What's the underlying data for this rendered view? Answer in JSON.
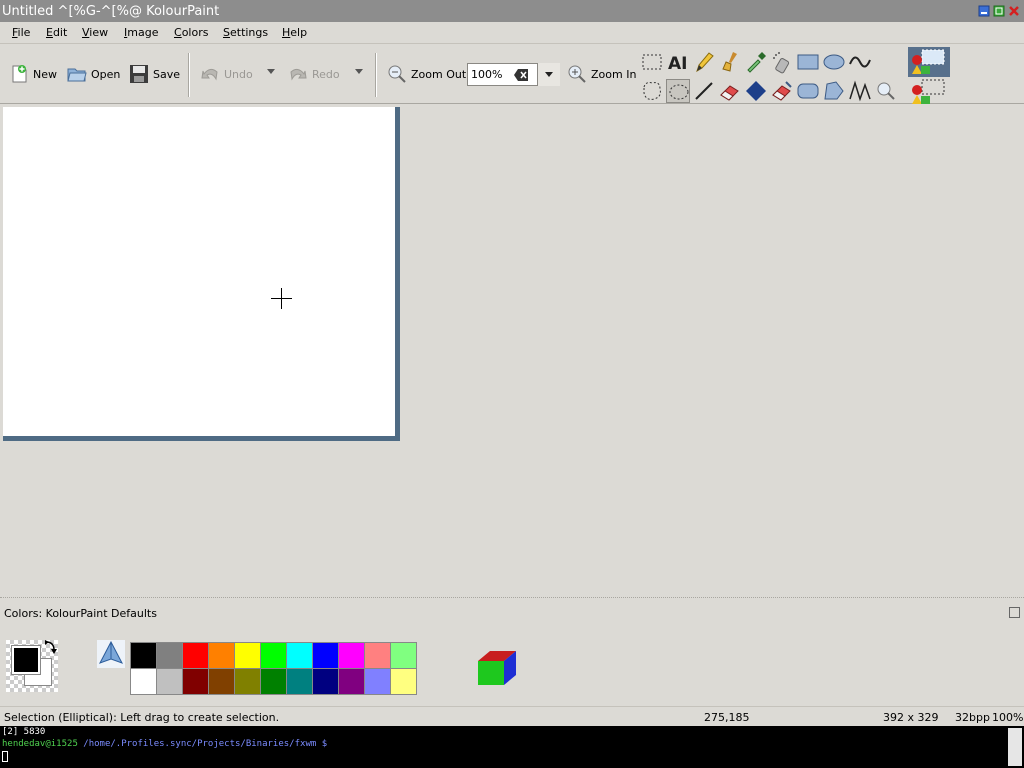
{
  "window": {
    "title": "Untitled ^[%G-^[%@ KolourPaint"
  },
  "menubar": {
    "items": [
      {
        "label": "File",
        "underline": "F"
      },
      {
        "label": "Edit",
        "underline": "E"
      },
      {
        "label": "View",
        "underline": "V"
      },
      {
        "label": "Image",
        "underline": "I"
      },
      {
        "label": "Colors",
        "underline": "C"
      },
      {
        "label": "Settings",
        "underline": "S"
      },
      {
        "label": "Help",
        "underline": "H"
      }
    ]
  },
  "toolbar": {
    "new_label": "New",
    "open_label": "Open",
    "save_label": "Save",
    "undo_label": "Undo",
    "redo_label": "Redo",
    "zoom_out_label": "Zoom Out",
    "zoom_value": "100%",
    "zoom_in_label": "Zoom In"
  },
  "toolbox": {
    "tools": [
      "selection-rectangular",
      "text",
      "pen",
      "brush",
      "color-picker",
      "spraycan",
      "rectangle",
      "ellipse",
      "curve",
      "selection-free-form",
      "selection-elliptical",
      "line",
      "eraser",
      "flood-fill",
      "color-eraser",
      "rounded-rectangle",
      "polygon",
      "connected-lines",
      "zoom"
    ],
    "active_tool": "selection-elliptical"
  },
  "colors": {
    "header_prefix": "Colors: ",
    "header_name": "KolourPaint Defaults",
    "foreground": "#000000",
    "background": "#ffffff",
    "palette_row1": [
      "#000000",
      "#808080",
      "#ff0000",
      "#ff8000",
      "#ffff00",
      "#00ff00",
      "#00ffff",
      "#0000ff",
      "#ff00ff",
      "#ff8080",
      "#80ff80"
    ],
    "palette_row2": [
      "#ffffff",
      "#c0c0c0",
      "#800000",
      "#804000",
      "#808000",
      "#008000",
      "#008080",
      "#000080",
      "#800080",
      "#8080ff",
      "#ffff80"
    ]
  },
  "canvas": {
    "border_color": "#4f6b84"
  },
  "status": {
    "message": "Selection (Elliptical): Left drag to create selection.",
    "cursor": "275,185",
    "size": "392 x 329",
    "depth": "32bpp",
    "zoom": "100%"
  },
  "terminal": {
    "line1": "[2] 5830",
    "user": "hendedav@i1525",
    "path": "/home/.Profiles.sync/Projects/Binaries/fxwm $"
  }
}
